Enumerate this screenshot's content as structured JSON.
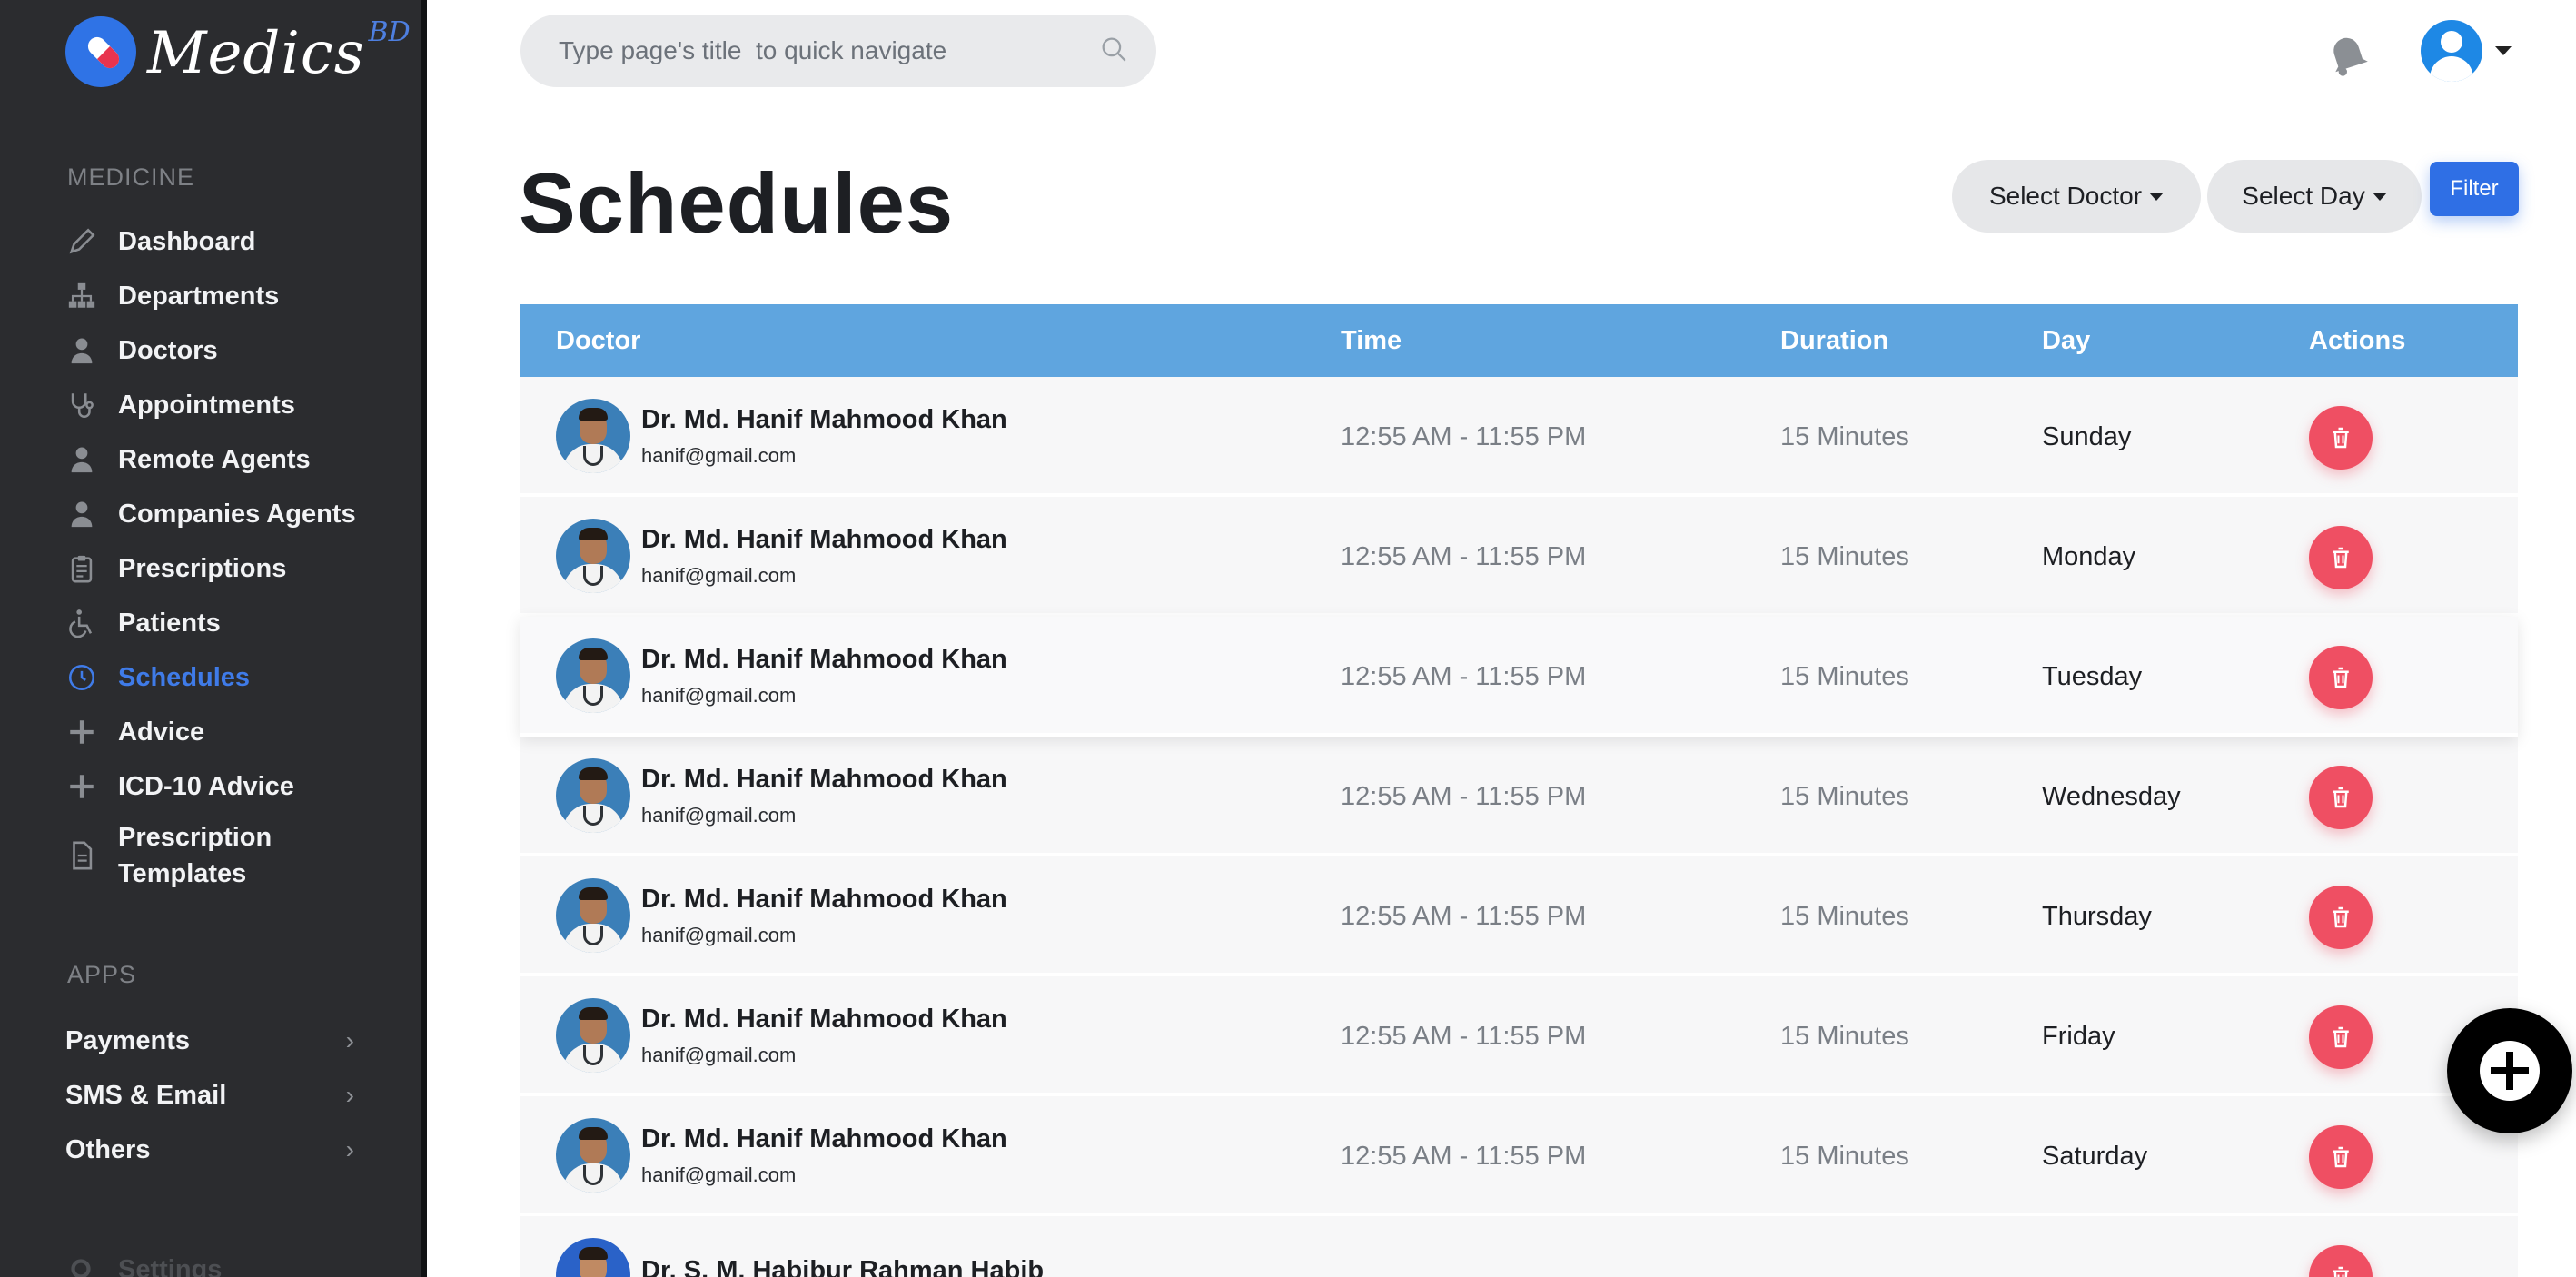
{
  "brand": {
    "name": "Medics",
    "suffix": "BD"
  },
  "sidebar": {
    "section_medicine": "MEDICINE",
    "items": [
      {
        "label": "Dashboard",
        "icon": "pen-icon"
      },
      {
        "label": "Departments",
        "icon": "sitemap-icon"
      },
      {
        "label": "Doctors",
        "icon": "user-doctor-icon"
      },
      {
        "label": "Appointments",
        "icon": "stethoscope-icon"
      },
      {
        "label": "Remote Agents",
        "icon": "user-doctor-icon"
      },
      {
        "label": "Companies Agents",
        "icon": "user-doctor-icon"
      },
      {
        "label": "Prescriptions",
        "icon": "clipboard-icon"
      },
      {
        "label": "Patients",
        "icon": "wheelchair-icon"
      },
      {
        "label": "Schedules",
        "icon": "clock-icon",
        "active": true
      },
      {
        "label": "Advice",
        "icon": "plus-icon"
      },
      {
        "label": "ICD-10 Advice",
        "icon": "plus-icon"
      },
      {
        "label": "Prescription Templates",
        "icon": "file-icon"
      }
    ],
    "section_apps": "APPS",
    "apps": [
      {
        "label": "Payments"
      },
      {
        "label": "SMS & Email"
      },
      {
        "label": "Others"
      }
    ],
    "settings_label": "Settings"
  },
  "search": {
    "placeholder": "Type page's title  to quick navigate",
    "value": ""
  },
  "page": {
    "title": "Schedules"
  },
  "filters": {
    "doctor_label": "Select Doctor",
    "day_label": "Select Day",
    "filter_label": "Filter"
  },
  "table": {
    "headers": {
      "doctor": "Doctor",
      "time": "Time",
      "duration": "Duration",
      "day": "Day",
      "actions": "Actions"
    },
    "rows": [
      {
        "name": "Dr. Md. Hanif Mahmood Khan",
        "email": "hanif@gmail.com",
        "time": "12:55 AM - 11:55 PM",
        "duration": "15 Minutes",
        "day": "Sunday"
      },
      {
        "name": "Dr. Md. Hanif Mahmood Khan",
        "email": "hanif@gmail.com",
        "time": "12:55 AM - 11:55 PM",
        "duration": "15 Minutes",
        "day": "Monday"
      },
      {
        "name": "Dr. Md. Hanif Mahmood Khan",
        "email": "hanif@gmail.com",
        "time": "12:55 AM - 11:55 PM",
        "duration": "15 Minutes",
        "day": "Tuesday"
      },
      {
        "name": "Dr. Md. Hanif Mahmood Khan",
        "email": "hanif@gmail.com",
        "time": "12:55 AM - 11:55 PM",
        "duration": "15 Minutes",
        "day": "Wednesday"
      },
      {
        "name": "Dr. Md. Hanif Mahmood Khan",
        "email": "hanif@gmail.com",
        "time": "12:55 AM - 11:55 PM",
        "duration": "15 Minutes",
        "day": "Thursday"
      },
      {
        "name": "Dr. Md. Hanif Mahmood Khan",
        "email": "hanif@gmail.com",
        "time": "12:55 AM - 11:55 PM",
        "duration": "15 Minutes",
        "day": "Friday"
      },
      {
        "name": "Dr. Md. Hanif Mahmood Khan",
        "email": "hanif@gmail.com",
        "time": "12:55 AM - 11:55 PM",
        "duration": "15 Minutes",
        "day": "Saturday"
      },
      {
        "name": "Dr. S. M. Habibur Rahman Habib",
        "email": "",
        "time": "",
        "duration": "",
        "day": ""
      }
    ]
  },
  "colors": {
    "sidebar_bg": "#2b2c2f",
    "accent": "#2f6fe5",
    "table_header": "#5fa5df",
    "delete": "#ef4f63"
  }
}
